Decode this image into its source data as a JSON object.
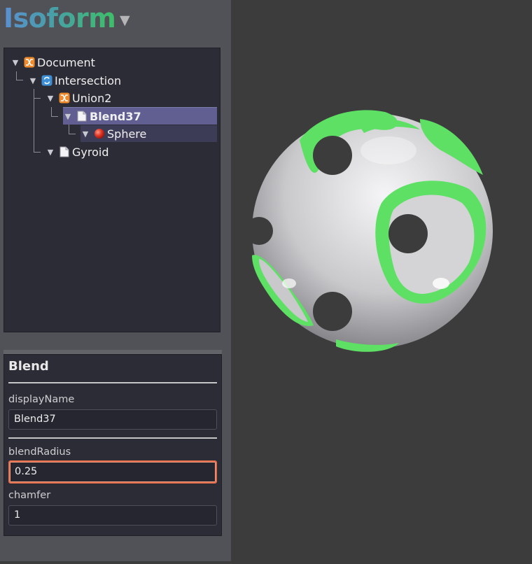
{
  "app": {
    "title": "Isoform",
    "menu_caret": "▼"
  },
  "tree": {
    "nodes": [
      {
        "id": "document",
        "label": "Document",
        "icon": "union-icon",
        "toggle": "▼"
      },
      {
        "id": "intersection",
        "label": "Intersection",
        "icon": "intersection-icon",
        "toggle": "▼"
      },
      {
        "id": "union2",
        "label": "Union2",
        "icon": "union-icon",
        "toggle": "▼"
      },
      {
        "id": "blend37",
        "label": "Blend37",
        "icon": "document-icon",
        "toggle": "▼",
        "selected": true
      },
      {
        "id": "sphere",
        "label": "Sphere",
        "icon": "sphere-icon",
        "toggle": "▼"
      },
      {
        "id": "gyroid",
        "label": "Gyroid",
        "icon": "document-icon",
        "toggle": "▼"
      }
    ]
  },
  "properties": {
    "title": "Blend",
    "fields": [
      {
        "label": "displayName",
        "value": "Blend37"
      },
      {
        "label": "blendRadius",
        "value": "0.25",
        "focused": true
      },
      {
        "label": "chamfer",
        "value": "1"
      }
    ]
  },
  "colors": {
    "title_gradient": [
      "#5b8fd0",
      "#3ebf67"
    ],
    "selection": "#615f92",
    "focus_border": "#e56f4c",
    "model_accent": "#5ee065"
  }
}
